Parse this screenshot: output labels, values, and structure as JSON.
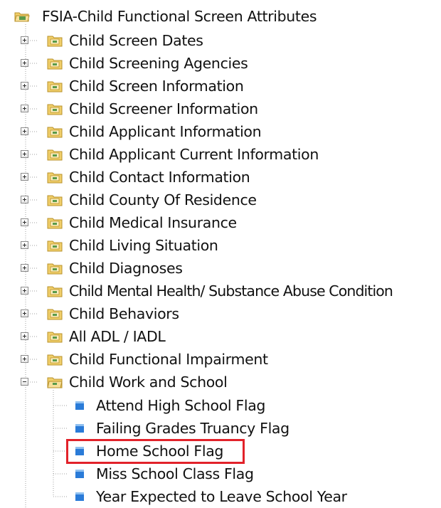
{
  "root": {
    "label": "FSIA-Child Functional Screen Attributes",
    "icon": "folder-open-icon"
  },
  "folders": [
    {
      "label": "Child Screen Dates",
      "state": "collapsed"
    },
    {
      "label": "Child Screening Agencies",
      "state": "collapsed"
    },
    {
      "label": "Child Screen Information",
      "state": "collapsed"
    },
    {
      "label": "Child Screener Information",
      "state": "collapsed"
    },
    {
      "label": "Child Applicant Information",
      "state": "collapsed"
    },
    {
      "label": "Child Applicant Current Information",
      "state": "collapsed"
    },
    {
      "label": "Child Contact Information",
      "state": "collapsed"
    },
    {
      "label": "Child County Of Residence",
      "state": "collapsed"
    },
    {
      "label": "Child Medical Insurance",
      "state": "collapsed"
    },
    {
      "label": "Child Living Situation",
      "state": "collapsed"
    },
    {
      "label": "Child Diagnoses",
      "state": "collapsed"
    },
    {
      "label": "Child Mental Health/ Substance Abuse Condition",
      "state": "collapsed"
    },
    {
      "label": "Child Behaviors",
      "state": "collapsed"
    },
    {
      "label": "All ADL / IADL",
      "state": "collapsed"
    },
    {
      "label": "Child Functional Impairment",
      "state": "collapsed"
    },
    {
      "label": "Child Work and School",
      "state": "expanded"
    }
  ],
  "expanded_children": [
    {
      "label": "Attend High School Flag"
    },
    {
      "label": "Failing Grades Truancy Flag"
    },
    {
      "label": "Home School Flag",
      "highlighted": true
    },
    {
      "label": "Miss School Class Flag"
    },
    {
      "label": "Year Expected to Leave School Year"
    }
  ],
  "colors": {
    "highlight_border": "#e2222a",
    "folder_fill": "#f1cf6a",
    "folder_edge": "#b8912a",
    "attribute_icon": "#2a7bd8",
    "tree_line": "#a0a0a0"
  }
}
